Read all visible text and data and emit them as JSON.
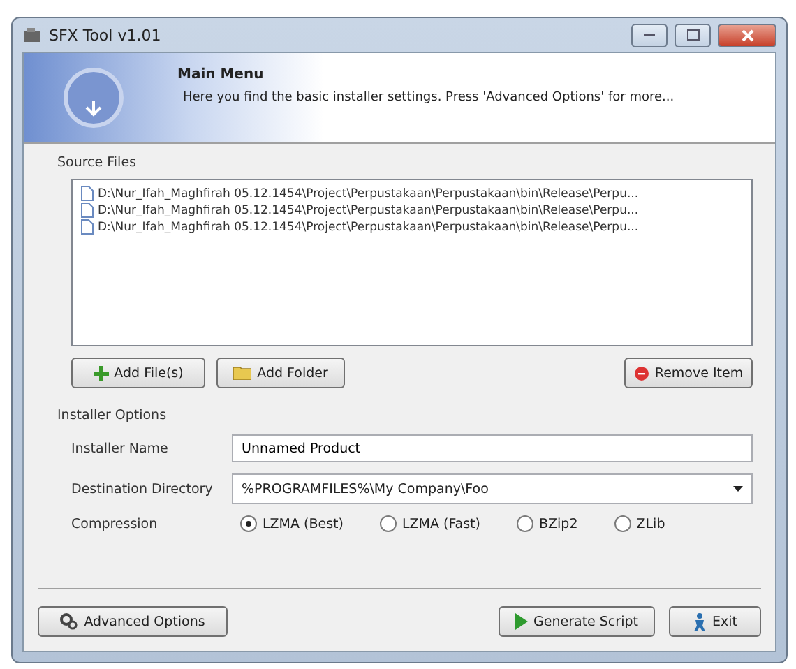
{
  "window": {
    "title": "SFX Tool v1.01"
  },
  "header": {
    "title": "Main Menu",
    "description": "Here you find the basic installer settings. Press 'Advanced Options' for more..."
  },
  "source_files": {
    "label": "Source Files",
    "items": [
      {
        "path": "D:\\Nur_Ifah_Maghfirah 05.12.1454\\Project\\Perpustakaan\\Perpustakaan\\bin\\Release\\Perpu..."
      },
      {
        "path": "D:\\Nur_Ifah_Maghfirah 05.12.1454\\Project\\Perpustakaan\\Perpustakaan\\bin\\Release\\Perpu..."
      },
      {
        "path": "D:\\Nur_Ifah_Maghfirah 05.12.1454\\Project\\Perpustakaan\\Perpustakaan\\bin\\Release\\Perpu..."
      }
    ],
    "buttons": [
      {
        "kind": "add-files",
        "label": "Add File(s)"
      },
      {
        "kind": "add-folder",
        "label": "Add Folder"
      },
      {
        "kind": "remove",
        "label": "Remove Item"
      }
    ]
  },
  "installer_options": {
    "label": "Installer Options",
    "installer_name": {
      "label": "Installer Name",
      "value": "Unnamed Product"
    },
    "destination": {
      "label": "Destination Directory",
      "value": "%PROGRAMFILES%\\My Company\\Foo"
    },
    "compression": {
      "label": "Compression",
      "options": [
        {
          "label": "LZMA (Best)",
          "selected": true
        },
        {
          "label": "LZMA (Fast)",
          "selected": false
        },
        {
          "label": "BZip2",
          "selected": false
        },
        {
          "label": "ZLib",
          "selected": false
        }
      ]
    }
  },
  "footer": {
    "buttons": [
      {
        "kind": "advanced",
        "label": "Advanced Options"
      },
      {
        "kind": "generate",
        "label": "Generate Script"
      },
      {
        "kind": "exit",
        "label": "Exit"
      }
    ]
  }
}
